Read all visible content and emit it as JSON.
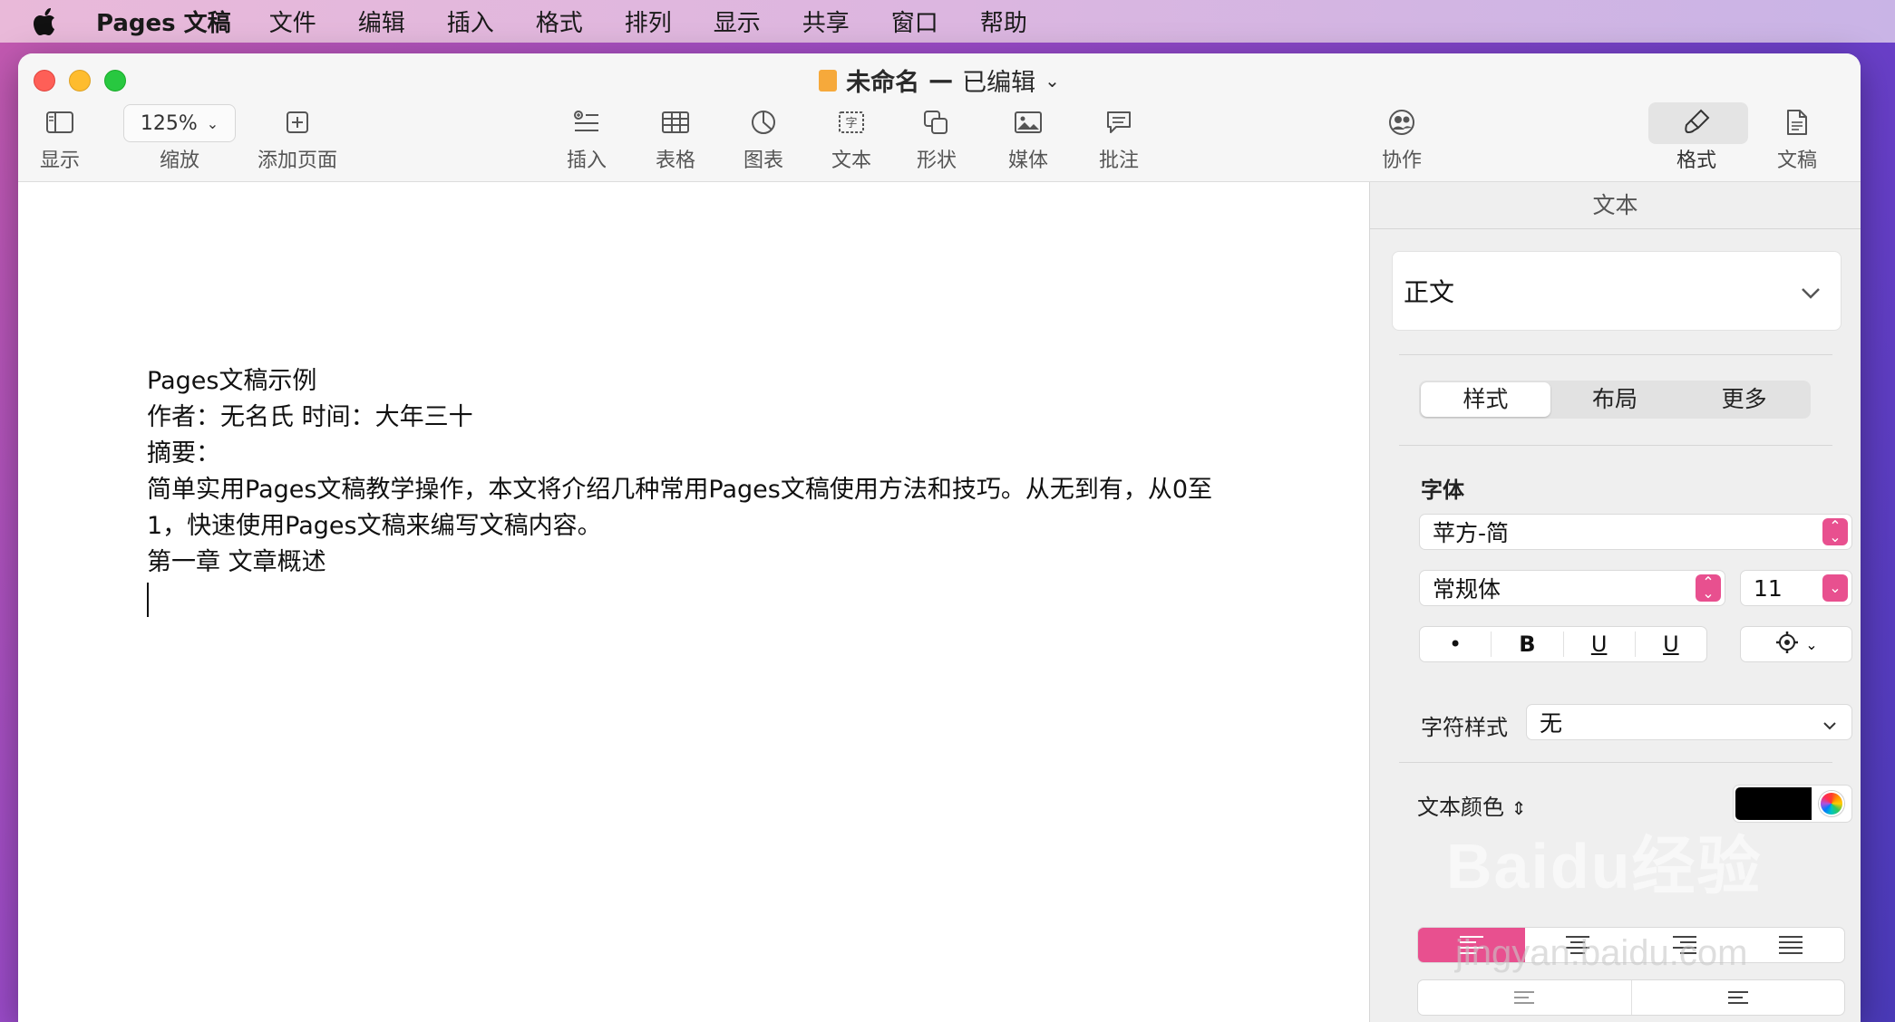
{
  "menubar": {
    "app_name": "Pages 文稿",
    "items": [
      "文件",
      "编辑",
      "插入",
      "格式",
      "排列",
      "显示",
      "共享",
      "窗口",
      "帮助"
    ]
  },
  "window": {
    "title_name": "未命名",
    "title_sep": "—",
    "title_status": "已编辑"
  },
  "toolbar": {
    "view_label": "显示",
    "zoom_value": "125%",
    "zoom_label": "缩放",
    "add_page_label": "添加页面",
    "insert_label": "插入",
    "table_label": "表格",
    "chart_label": "图表",
    "text_label": "文本",
    "shape_label": "形状",
    "media_label": "媒体",
    "comment_label": "批注",
    "collaborate_label": "协作",
    "format_label": "格式",
    "document_label": "文稿",
    "text_icon_char": "字"
  },
  "document": {
    "lines": [
      "Pages文稿示例",
      "作者：无名氏 时间：大年三十",
      "摘要：",
      "简单实用Pages文稿教学操作，本文将介绍几种常用Pages文稿使用方法和技巧。从无到有，从0至",
      "1，快速使用Pages文稿来编写文稿内容。",
      "第一章 文章概述"
    ]
  },
  "inspector": {
    "header": "文本",
    "paragraph_style": "正文",
    "tabs": [
      "样式",
      "布局",
      "更多"
    ],
    "font_section": "字体",
    "font_family": "苹方-简",
    "font_typeface": "常规体",
    "font_size": "11",
    "style_buttons": [
      "•",
      "B",
      "U",
      "U"
    ],
    "char_style_label": "字符样式",
    "char_style_value": "无",
    "text_color_label": "文本颜色",
    "text_color": "#000000",
    "accent_color": "#e8508f"
  },
  "watermark": {
    "main": "Baidu经验",
    "sub": "jingyan.baidu.com"
  }
}
